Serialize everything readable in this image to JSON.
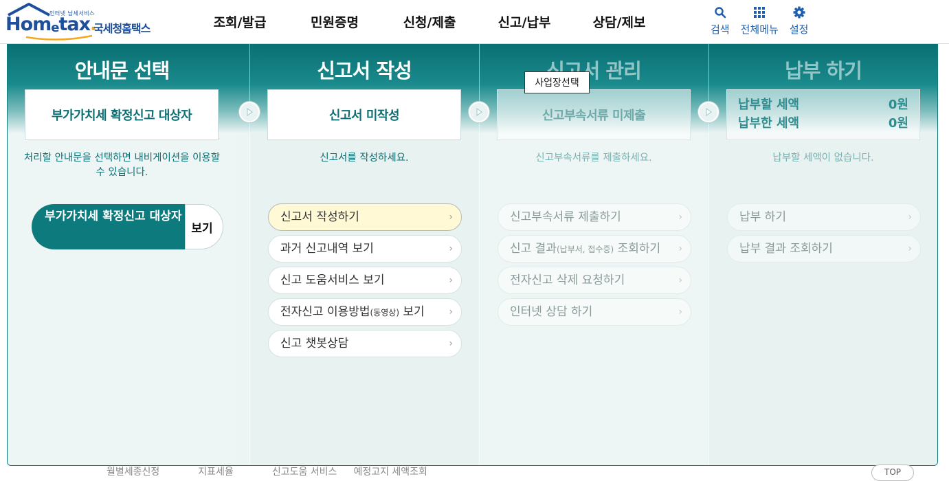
{
  "header": {
    "logo_small": "인터넷 납세서비스",
    "logo_brand_1": "Hom",
    "logo_brand_2": "e",
    "logo_brand_3": "tax",
    "logo_brand_dot": ".",
    "logo_korean": "국세청홈택스",
    "nav": [
      "조회/발급",
      "민원증명",
      "신청/제출",
      "신고/납부",
      "상담/제보"
    ],
    "util": [
      {
        "label": "검색",
        "icon": "search-icon"
      },
      {
        "label": "전체메뉴",
        "icon": "grid-menu-icon"
      },
      {
        "label": "설정",
        "icon": "gear-icon"
      }
    ],
    "accent": "#1d5fae"
  },
  "columns": {
    "guide": {
      "title": "안내문 선택",
      "status": "부가가치세 확정신고 대상자",
      "desc": "처리할 안내문을 선택하면 내비게이션을 이용할 수 있습니다.",
      "select_label": "부가가치세 확정신고 대상자",
      "view_label": "보기"
    },
    "write": {
      "title": "신고서 작성",
      "status": "신고서 미작성",
      "desc": "신고서를 작성하세요.",
      "buttons": [
        {
          "label": "신고서 작성하기",
          "small": "",
          "suffix": ""
        },
        {
          "label": "과거 신고내역 보기",
          "small": "",
          "suffix": ""
        },
        {
          "label": "신고 도움서비스 보기",
          "small": "",
          "suffix": ""
        },
        {
          "label": "전자신고 이용방법",
          "small": "(동영상)",
          "suffix": " 보기"
        },
        {
          "label": "신고 챗봇상담",
          "small": "",
          "suffix": ""
        }
      ]
    },
    "manage": {
      "title": "신고서 관리",
      "status": "신고부속서류 미제출",
      "desc": "신고부속서류를 제출하세요.",
      "buttons": [
        {
          "label": "신고부속서류 제출하기",
          "small": "",
          "suffix": ""
        },
        {
          "label": "신고 결과",
          "small": "(납부서, 접수증)",
          "suffix": " 조회하기"
        },
        {
          "label": "전자신고 삭제 요청하기",
          "small": "",
          "suffix": ""
        },
        {
          "label": "인터넷 상담 하기",
          "small": "",
          "suffix": ""
        }
      ]
    },
    "pay": {
      "title": "납부 하기",
      "due_label": "납부할 세액",
      "due_value": "0원",
      "paid_label": "납부한 세액",
      "paid_value": "0원",
      "desc": "납부할 세액이 없습니다.",
      "buttons": [
        {
          "label": "납부 하기"
        },
        {
          "label": "납부 결과 조회하기"
        }
      ]
    }
  },
  "tooltip": "사업장선택",
  "footer": {
    "links": [
      "월별세종신정",
      "지표세율",
      "신고도움 서비스",
      "예정고지 세액조회"
    ],
    "top": "TOP"
  },
  "colors": {
    "teal": "#0d7b7e",
    "highlight": "#fff9d6"
  }
}
